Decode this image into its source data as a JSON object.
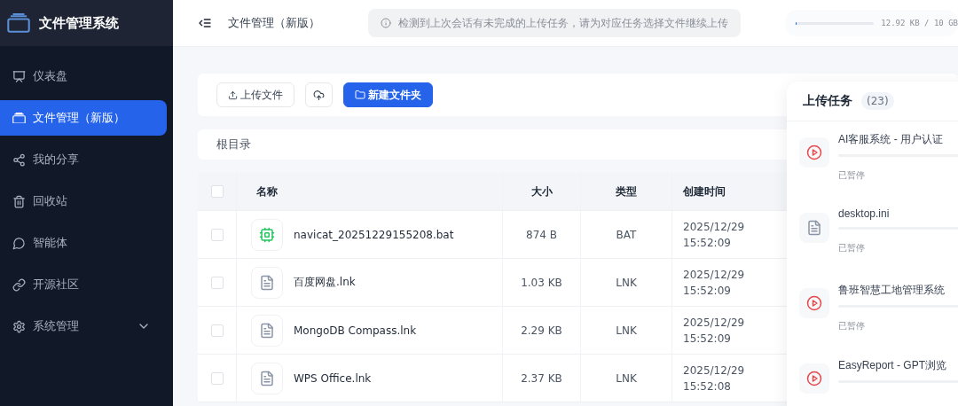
{
  "app": {
    "title": "文件管理系统"
  },
  "sidebar": {
    "items": [
      {
        "label": "仪表盘",
        "selected": false
      },
      {
        "label": "文件管理（新版）",
        "selected": true
      },
      {
        "label": "我的分享",
        "selected": false
      },
      {
        "label": "回收站",
        "selected": false
      },
      {
        "label": "智能体",
        "selected": false
      },
      {
        "label": "开源社区",
        "selected": false
      },
      {
        "label": "系统管理",
        "selected": false,
        "expandable": true
      }
    ]
  },
  "header": {
    "page_title": "文件管理（新版）",
    "notice": "检测到上次会话有未完成的上传任务，请为对应任务选择文件继续上传",
    "storage": {
      "reading": "12.92 KB / 10 GB",
      "level": 0.01
    }
  },
  "toolbar": {
    "upload": "上传文件",
    "new_folder": "新建文件夹"
  },
  "breadcrumb": "根目录",
  "table": {
    "all_selected": false,
    "columns": [
      "名称",
      "大小",
      "类型",
      "创建时间"
    ],
    "rows": [
      {
        "kind": "chip",
        "name": "navicat_20251229155208.bat",
        "size": "874 B",
        "type": "BAT",
        "created": [
          "2025/12/29",
          "15:52:09"
        ],
        "selected": false
      },
      {
        "kind": "doc",
        "name": "百度网盘.lnk",
        "size": "1.03 KB",
        "type": "LNK",
        "created": [
          "2025/12/29",
          "15:52:09"
        ],
        "selected": false
      },
      {
        "kind": "doc",
        "name": "MongoDB Compass.lnk",
        "size": "2.29 KB",
        "type": "LNK",
        "created": [
          "2025/12/29",
          "15:52:09"
        ],
        "selected": false
      },
      {
        "kind": "doc",
        "name": "WPS Office.lnk",
        "size": "2.37 KB",
        "type": "LNK",
        "created": [
          "2025/12/29",
          "15:52:08"
        ],
        "selected": false
      }
    ]
  },
  "upload_panel": {
    "title": "上传任务",
    "count": "(23)",
    "tasks": [
      {
        "kind": "video",
        "name": "AI客服系统 - 用户认证",
        "status": "已暂停"
      },
      {
        "kind": "doc",
        "name": "desktop.ini",
        "status": "已暂停"
      },
      {
        "kind": "video",
        "name": "鲁班智慧工地管理系统",
        "status": "已暂停"
      },
      {
        "kind": "video",
        "name": "EasyReport - GPT浏览"
      }
    ]
  }
}
